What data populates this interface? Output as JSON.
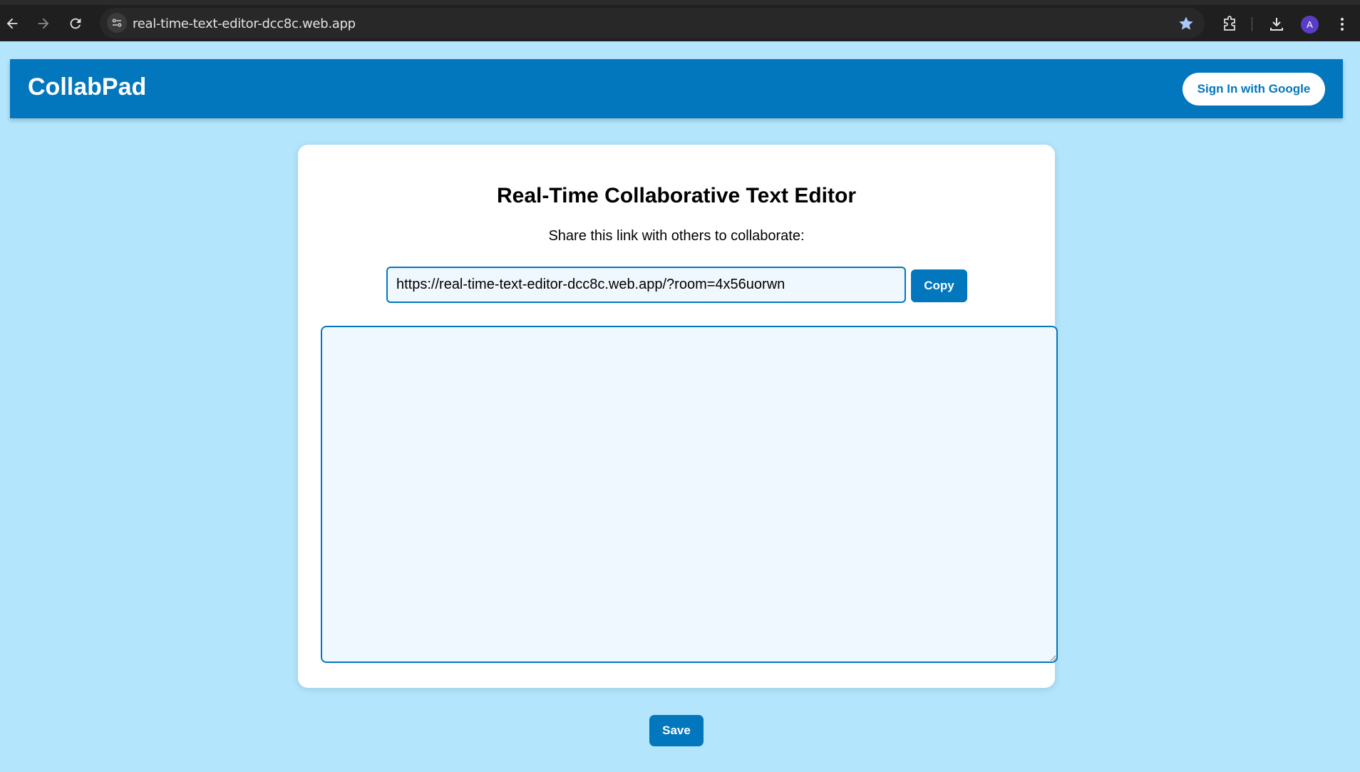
{
  "browser": {
    "url": "real-time-text-editor-dcc8c.web.app",
    "avatar_letter": "A",
    "icons": [
      "back-arrow-icon",
      "forward-arrow-icon",
      "reload-icon",
      "site-settings-icon",
      "bookmark-star-icon",
      "extensions-icon",
      "download-icon",
      "kebab-menu-icon"
    ]
  },
  "header": {
    "brand": "CollabPad",
    "signin_label": "Sign In with Google"
  },
  "editor_card": {
    "title": "Real-Time Collaborative Text Editor",
    "subtitle": "Share this link with others to collaborate:",
    "share_link": "https://real-time-text-editor-dcc8c.web.app/?room=4x56uorwn",
    "copy_label": "Copy",
    "editor_text": ""
  },
  "save_label": "Save",
  "colors": {
    "primary": "#0277bd",
    "page_background": "#b3e5fc",
    "field_background": "#f0f8ff",
    "card_background": "#ffffff"
  }
}
